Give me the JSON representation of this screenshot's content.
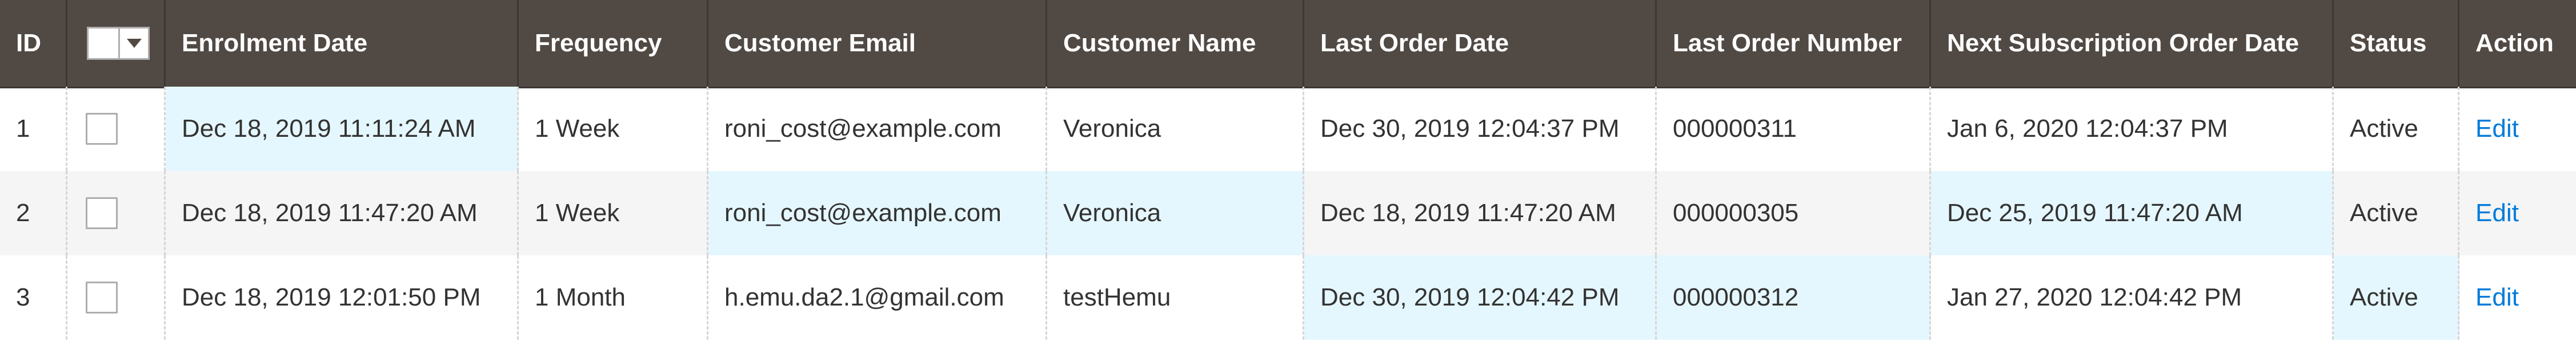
{
  "columns": {
    "id": "ID",
    "enrolment_date": "Enrolment Date",
    "frequency": "Frequency",
    "customer_email": "Customer Email",
    "customer_name": "Customer Name",
    "last_order_date": "Last Order Date",
    "last_order_number": "Last Order Number",
    "next_subscription_order_date": "Next Subscription Order Date",
    "status": "Status",
    "action": "Action"
  },
  "rows": [
    {
      "id": "1",
      "enrolment_date": "Dec 18, 2019 11:11:24 AM",
      "frequency": "1 Week",
      "customer_email": "roni_cost@example.com",
      "customer_name": "Veronica",
      "last_order_date": "Dec 30, 2019 12:04:37 PM",
      "last_order_number": "000000311",
      "next_subscription_order_date": "Jan 6, 2020 12:04:37 PM",
      "status": "Active",
      "action": "Edit"
    },
    {
      "id": "2",
      "enrolment_date": "Dec 18, 2019 11:47:20 AM",
      "frequency": "1 Week",
      "customer_email": "roni_cost@example.com",
      "customer_name": "Veronica",
      "last_order_date": "Dec 18, 2019 11:47:20 AM",
      "last_order_number": "000000305",
      "next_subscription_order_date": "Dec 25, 2019 11:47:20 AM",
      "status": "Active",
      "action": "Edit"
    },
    {
      "id": "3",
      "enrolment_date": "Dec 18, 2019 12:01:50 PM",
      "frequency": "1 Month",
      "customer_email": "h.emu.da2.1@gmail.com",
      "customer_name": "testHemu",
      "last_order_date": "Dec 30, 2019 12:04:42 PM",
      "last_order_number": "000000312",
      "next_subscription_order_date": "Jan 27, 2020 12:04:42 PM",
      "status": "Active",
      "action": "Edit"
    }
  ],
  "colors": {
    "header_bg": "#514943",
    "row_alt_bg": "#f5f5f5",
    "highlight_bg": "#e5f7fe",
    "link": "#007bdb"
  },
  "icons": {
    "mass_select_dropdown": "chevron-down-icon"
  }
}
